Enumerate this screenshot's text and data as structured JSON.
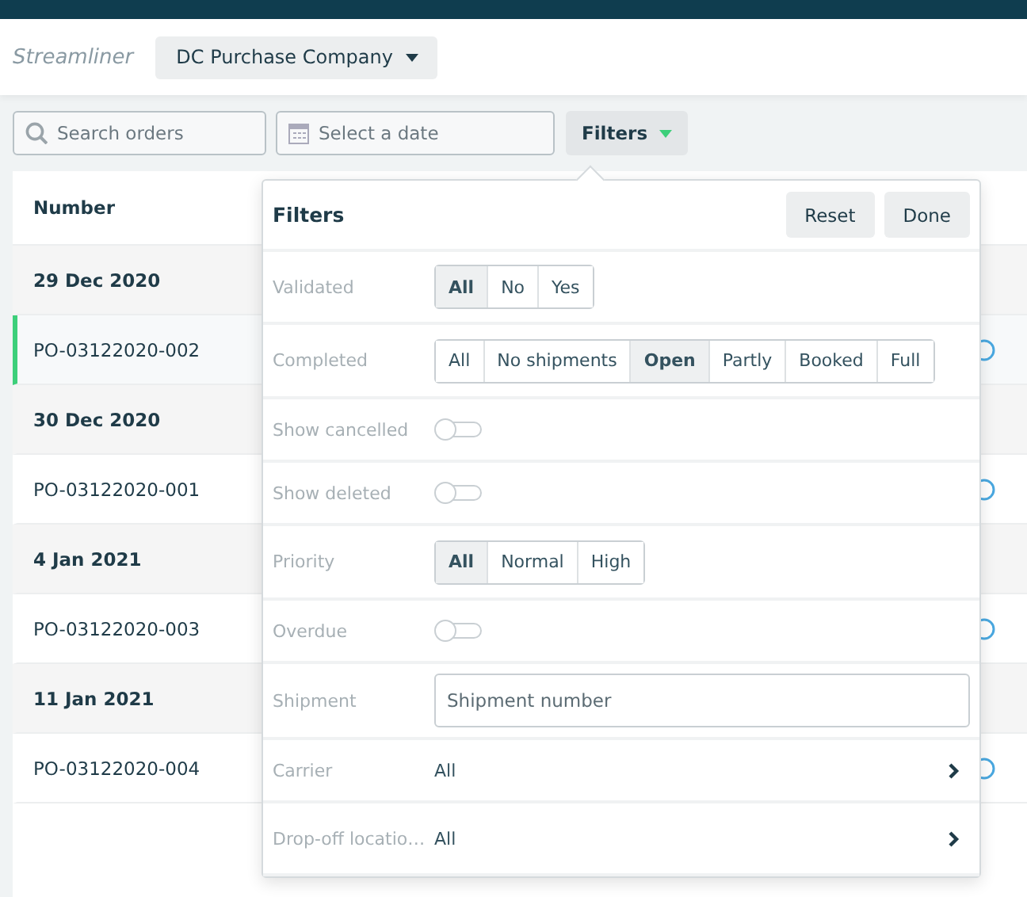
{
  "header": {
    "app_name": "Streamliner",
    "company": "DC Purchase Company"
  },
  "toolbar": {
    "search": {
      "placeholder": "Search orders"
    },
    "date": {
      "placeholder": "Select a date"
    },
    "filters_button": "Filters"
  },
  "orders": {
    "columns": [
      "Number"
    ],
    "rows": [
      {
        "kind": "group",
        "label": "29 Dec 2020"
      },
      {
        "kind": "order",
        "label": "PO-03122020-002",
        "selected": true
      },
      {
        "kind": "group",
        "label": "30 Dec 2020"
      },
      {
        "kind": "order",
        "label": "PO-03122020-001",
        "selected": false
      },
      {
        "kind": "group",
        "label": "4 Jan 2021"
      },
      {
        "kind": "order",
        "label": "PO-03122020-003",
        "selected": false
      },
      {
        "kind": "group",
        "label": "11 Jan 2021"
      },
      {
        "kind": "order",
        "label": "PO-03122020-004",
        "selected": false
      }
    ]
  },
  "filters": {
    "title": "Filters",
    "buttons": [
      "Reset",
      "Done"
    ],
    "rows": [
      {
        "kind": "segmented",
        "label": "Validated",
        "options": [
          {
            "label": "All",
            "selected": true
          },
          {
            "label": "No",
            "selected": false
          },
          {
            "label": "Yes",
            "selected": false
          }
        ]
      },
      {
        "kind": "segmented",
        "label": "Completed",
        "options": [
          {
            "label": "All",
            "selected": false
          },
          {
            "label": "No shipments",
            "selected": false
          },
          {
            "label": "Open",
            "selected": true
          },
          {
            "label": "Partly",
            "selected": false
          },
          {
            "label": "Booked",
            "selected": false
          },
          {
            "label": "Full",
            "selected": false
          }
        ]
      },
      {
        "kind": "toggle",
        "label": "Show cancelled",
        "on": false
      },
      {
        "kind": "toggle",
        "label": "Show deleted",
        "on": false
      },
      {
        "kind": "segmented",
        "label": "Priority",
        "options": [
          {
            "label": "All",
            "selected": true
          },
          {
            "label": "Normal",
            "selected": false
          },
          {
            "label": "High",
            "selected": false
          }
        ]
      },
      {
        "kind": "toggle",
        "label": "Overdue",
        "on": false
      },
      {
        "kind": "input",
        "label": "Shipment",
        "placeholder": "Shipment number"
      },
      {
        "kind": "select",
        "label": "Carrier",
        "value": "All"
      },
      {
        "kind": "select",
        "label": "Drop-off locatio…",
        "value": "All"
      }
    ]
  }
}
